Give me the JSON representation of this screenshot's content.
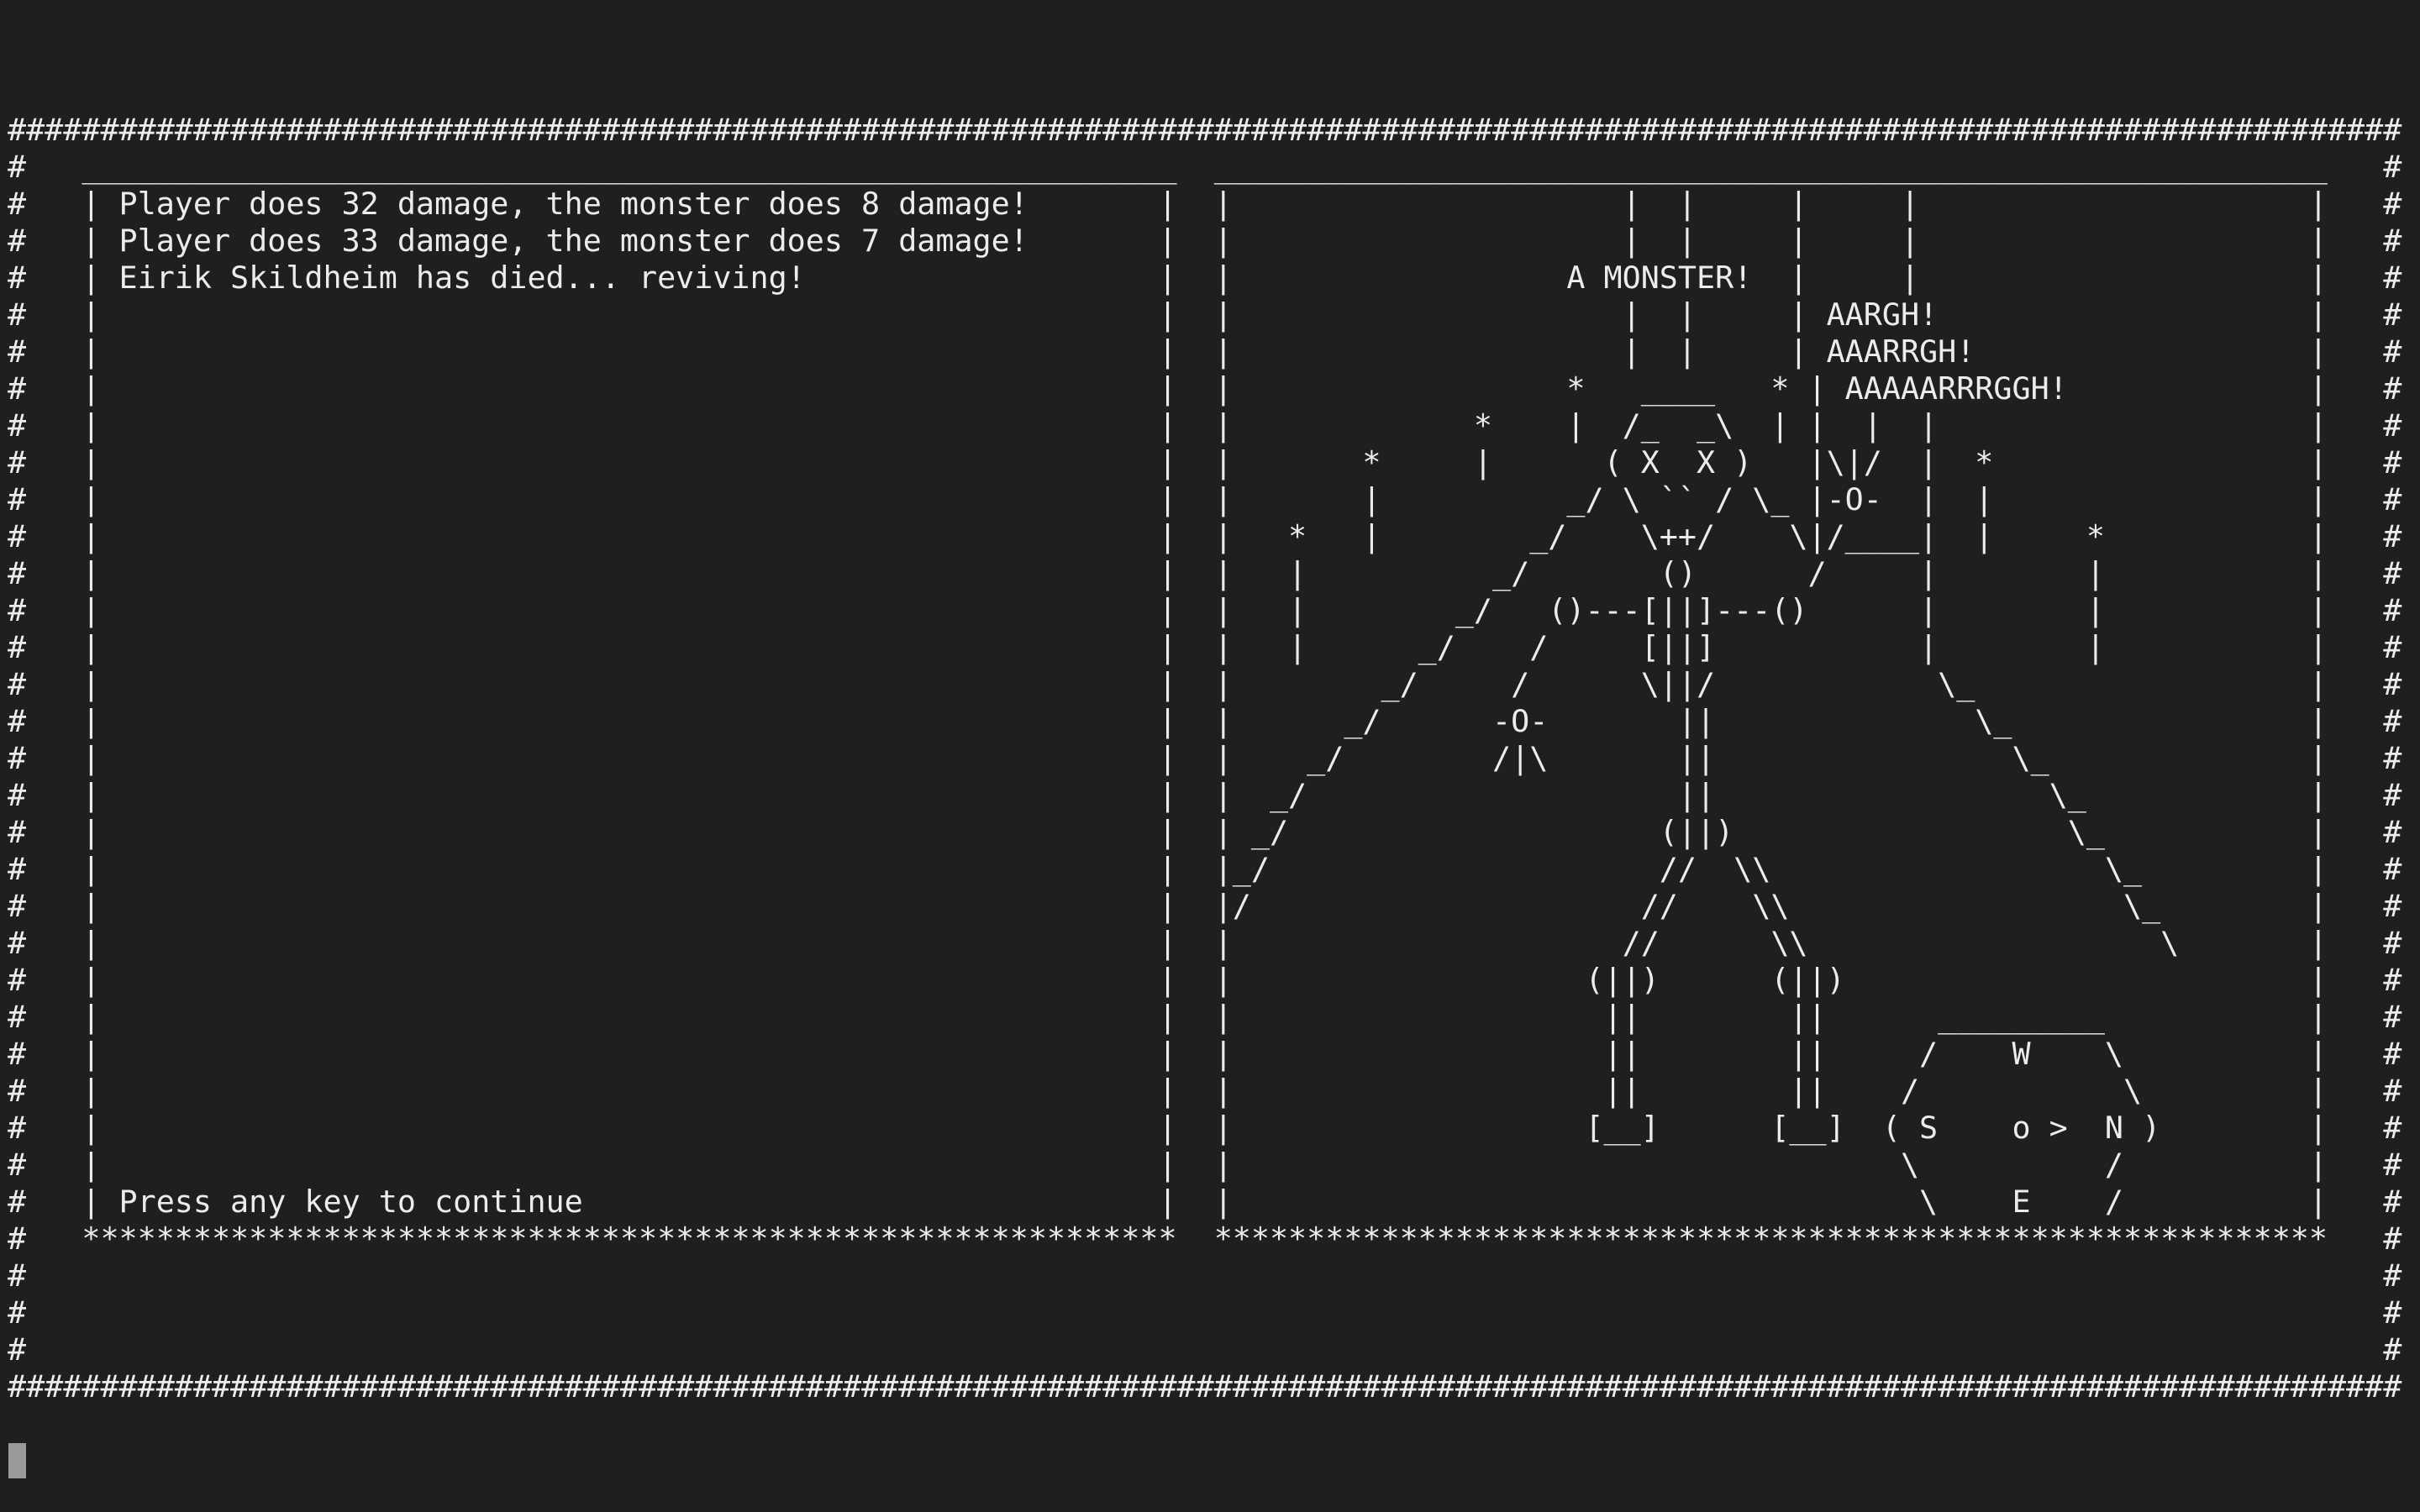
{
  "log_panel": {
    "messages": [
      "Player does 32 damage, the monster does 8 damage!",
      "Player does 33 damage, the monster does 7 damage!",
      "Eirik Skildheim has died... reviving!"
    ],
    "prompt": "Press any key to continue"
  },
  "scene_panel": {
    "monster_label": "A MONSTER!",
    "shouts": [
      "AARGH!",
      "AAARRGH!",
      "AAAAARRRGGH!"
    ],
    "compass": {
      "north": "N",
      "south": "S",
      "east": "E",
      "west": "W",
      "player_marker": "o >"
    }
  },
  "screen_rows": [
    "#################################################################",
    "#  __________________________________________________________   ____________________________________________________________   #",
    "#  | Player does 32 damage, the monster does 8 damage!      |  |                    |  |     |     |                  |   #",
    "#  | Player does 33 damage, the monster does 7 damage!      |  |                    |  |     |     |                  |   #",
    "#  | Eirik Skildheim has died... reviving!                  |  |                 A MONSTER!  |     |                  |   #",
    "#  |                                                        |  |                    |  |     | AARGH!               |   #",
    "#  |                                                        |  |                    |  |     | AAARRGH!             |   #",
    "#  |                                                        |  |                 *   ____   * | AAAAARRRGGH!         |   #",
    "#  |                                                        |  |            *    |  /_  _\\  | |  |  |                |   #",
    "#  |                                                        |  |      *     |      ( X  X )   |\\|/  |  *             |   #",
    "#  |                                                        |  |      |          _/ \\ `` / \\_ |-O-  |  |             |   #",
    "#  |                                                        |  |  *   |        _/    \\++/    \\|/____|  |     *       |   #",
    "#  |                                                        |  |  |          _/       ()      /     |        |       |   #",
    "#  |                                                        |  |  |        _/   ()---[||]---()      |        |       |   #",
    "#  |                                                        |  |  |      _/    /     [||]           |        |       |   #",
    "#  |                                                        |  |       _/     /      \\||/            \\_               |   #",
    "#  |                                                        |  |     _/      -O-       ||              \\_             |   #",
    "#  |                                                        |  |   _/        /|\\       ||                \\_           |   #",
    "#  |                                                        |  |  _/                   ||                  \\_         |   #",
    "#  |                                                        |  | _/                   (||)                  \\_       |   #",
    "#  |                                                        |  |_/                    //  \\\\                  \\_     |   #",
    "#  |                                                        |  |_/                   //    \\\\                  \\_   |   #",
    "#  |                                                        |  |/                   //      \\\\                   \\  |   #",
    "#  |                                                        |  |                  (||)      (||)                    |   #",
    "#  |                                                        |  |                   ||        ||      _________      |   #",
    "#  |                                                        |  |                   ||        ||     /    W    \\     |   #",
    "#  |                                                        |  |                   ||        ||    /           \\    |   #",
    "#  |                                                        |  |                  [__]      [__]  ( S    o >  N )   |   #",
    "#  |                                                        |  |                                   \\          / |   #",
    "#  | Press any key to continue                              |  |                                    \\    E    /  |   #",
    "#  **********************************************************   ************************************************************   #",
    "#                                                                                                                              #",
    "#                                                                                                                              #",
    "#                                                                                                                              #",
    "################################################################################################################################"
  ]
}
